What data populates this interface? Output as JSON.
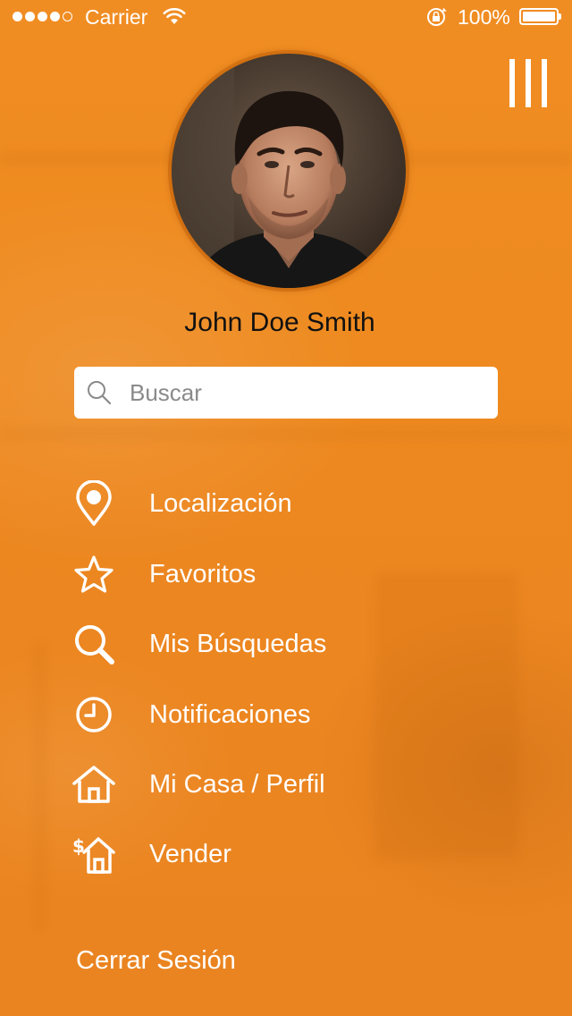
{
  "status_bar": {
    "carrier": "Carrier",
    "battery_percent": "100%",
    "signal_bars_filled": 4,
    "signal_bars_total": 5
  },
  "profile": {
    "name": "John Doe Smith",
    "avatar_icon": "profile-photo"
  },
  "search": {
    "placeholder": "Buscar",
    "value": "",
    "icon": "search-icon"
  },
  "menu": {
    "items": [
      {
        "label": "Localización",
        "icon": "location-pin-icon"
      },
      {
        "label": "Favoritos",
        "icon": "star-icon"
      },
      {
        "label": "Mis Búsquedas",
        "icon": "magnifier-icon"
      },
      {
        "label": "Notificaciones",
        "icon": "clock-icon"
      },
      {
        "label": "Mi Casa / Perfil",
        "icon": "house-icon"
      },
      {
        "label": "Vender",
        "icon": "house-dollar-icon"
      }
    ],
    "logout_label": "Cerrar Sesión"
  },
  "colors": {
    "accent": "#ec8a1f",
    "text_light": "#ffffff",
    "text_dark": "#111111",
    "search_bg": "#ffffff"
  }
}
